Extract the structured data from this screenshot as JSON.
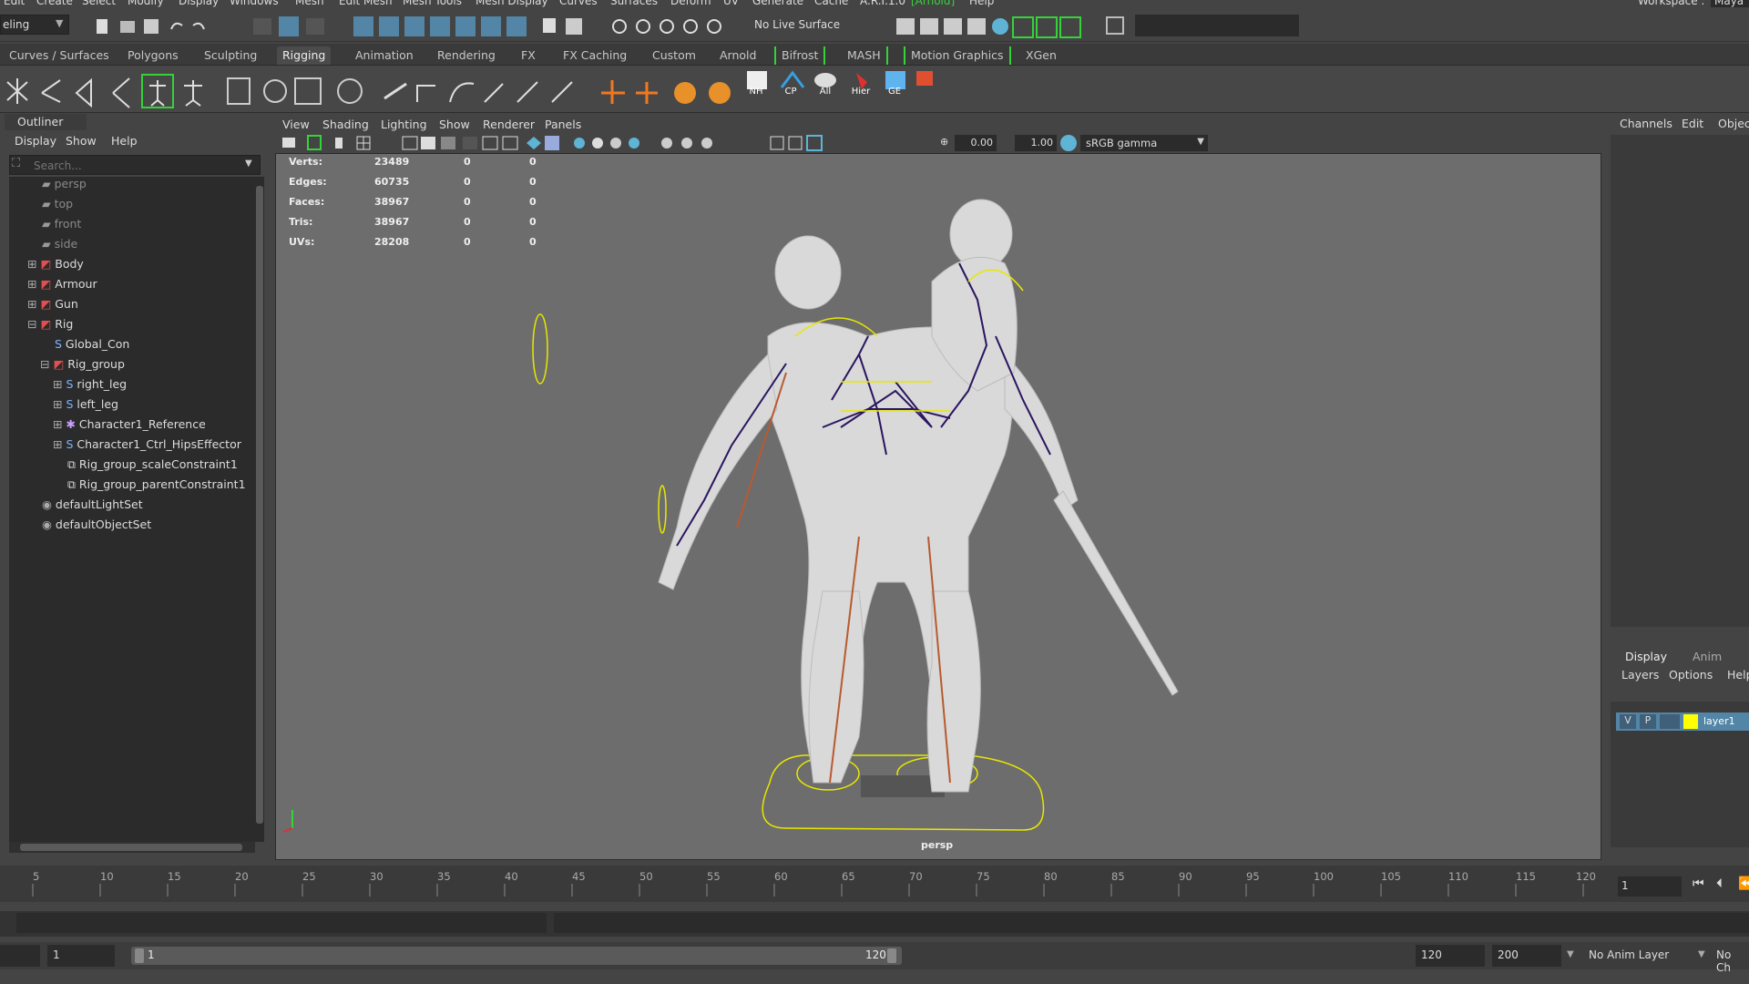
{
  "menubar": {
    "items": [
      "Edit",
      "Create",
      "Select",
      "Modify",
      "Display",
      "Windows",
      "Mesh",
      "Edit Mesh",
      "Mesh Tools",
      "Mesh Display",
      "Curves",
      "Surfaces",
      "Deform",
      "UV",
      "Generate",
      "Cache",
      "A.R.I.1.0",
      "[Arnold]",
      "Help"
    ],
    "workspace_label": "Workspace :",
    "workspace_value": "Maya C"
  },
  "toolbar": {
    "mode_value": "eling",
    "live_surface": "No Live Surface"
  },
  "shelf_tabs": [
    "Curves / Surfaces",
    "Polygons",
    "Sculpting",
    "Rigging",
    "Animation",
    "Rendering",
    "FX",
    "FX Caching",
    "Custom",
    "Arnold",
    "Bifrost",
    "MASH",
    "Motion Graphics",
    "XGen"
  ],
  "shelf_active_tab": "Rigging",
  "shelf_captions": [
    "NH",
    "CP",
    "All",
    "Hier",
    "GE"
  ],
  "outliner": {
    "title": "Outliner",
    "menu": [
      "Display",
      "Show",
      "Help"
    ],
    "search_placeholder": "Search...",
    "items": [
      {
        "label": "persp",
        "type": "camera"
      },
      {
        "label": "top",
        "type": "camera"
      },
      {
        "label": "front",
        "type": "camera"
      },
      {
        "label": "side",
        "type": "camera"
      },
      {
        "label": "Body",
        "type": "group"
      },
      {
        "label": "Armour",
        "type": "group"
      },
      {
        "label": "Gun",
        "type": "group"
      },
      {
        "label": "Rig",
        "type": "group"
      },
      {
        "label": "Global_Con",
        "type": "curve"
      },
      {
        "label": "Rig_group",
        "type": "group"
      },
      {
        "label": "right_leg",
        "type": "curve"
      },
      {
        "label": "left_leg",
        "type": "curve"
      },
      {
        "label": "Character1_Reference",
        "type": "joint"
      },
      {
        "label": "Character1_Ctrl_HipsEffector",
        "type": "curve"
      },
      {
        "label": "Rig_group_scaleConstraint1",
        "type": "constraint"
      },
      {
        "label": "Rig_group_parentConstraint1",
        "type": "constraint"
      },
      {
        "label": "defaultLightSet",
        "type": "set"
      },
      {
        "label": "defaultObjectSet",
        "type": "set"
      }
    ]
  },
  "viewport": {
    "menu": [
      "View",
      "Shading",
      "Lighting",
      "Show",
      "Renderer",
      "Panels"
    ],
    "exposure": "0.00",
    "gamma": "1.00",
    "color_space": "sRGB gamma",
    "camera_label": "persp",
    "hud": [
      {
        "label": "Verts:",
        "v1": "23489",
        "v2": "0",
        "v3": "0"
      },
      {
        "label": "Edges:",
        "v1": "60735",
        "v2": "0",
        "v3": "0"
      },
      {
        "label": "Faces:",
        "v1": "38967",
        "v2": "0",
        "v3": "0"
      },
      {
        "label": "Tris:",
        "v1": "38967",
        "v2": "0",
        "v3": "0"
      },
      {
        "label": "UVs:",
        "v1": "28208",
        "v2": "0",
        "v3": "0"
      }
    ]
  },
  "right_panel": {
    "top_tabs": [
      "Channels",
      "Edit",
      "Object"
    ],
    "bottom_tabs": [
      "Display",
      "Anim"
    ],
    "bottom_menu": [
      "Layers",
      "Options",
      "Help"
    ],
    "layer": {
      "v": "V",
      "p": "P",
      "name": "layer1",
      "color": "#ffff00"
    }
  },
  "timeline": {
    "ticks": [
      "5",
      "10",
      "15",
      "20",
      "25",
      "30",
      "35",
      "40",
      "45",
      "50",
      "55",
      "60",
      "65",
      "70",
      "75",
      "80",
      "85",
      "90",
      "95",
      "100",
      "105",
      "110",
      "115",
      "120"
    ],
    "current_frame": "1"
  },
  "range": {
    "start": "1",
    "inner_start": "1",
    "inner_end": "120",
    "end": "120",
    "anim_end": "200",
    "anim_layer": "No Anim Layer",
    "char_set": "No Ch"
  },
  "colors": {
    "accent_green": "#36d23a",
    "selection_yellow": "#e8e800",
    "joint_purple": "#2a1560"
  }
}
